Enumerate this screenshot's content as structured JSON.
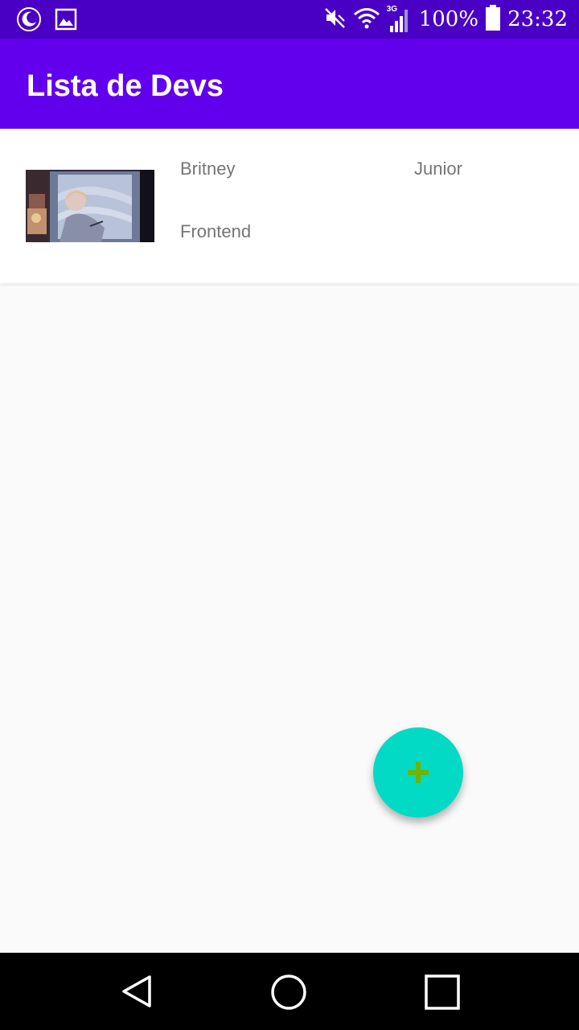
{
  "status_bar": {
    "battery_percent": "100%",
    "time": "23:32",
    "network_type": "3G",
    "icons": [
      "moon-icon",
      "image-icon",
      "mute-icon",
      "wifi-icon",
      "signal-icon",
      "battery-icon"
    ]
  },
  "app_bar": {
    "title": "Lista de Devs"
  },
  "developers": [
    {
      "name": "Britney",
      "level": "Junior",
      "area": "Frontend",
      "photo_icon": "developer-photo"
    }
  ],
  "fab": {
    "icon": "plus-icon",
    "color": "#03dac5"
  },
  "nav_bar": {
    "icons": [
      "back-icon",
      "home-icon",
      "recents-icon"
    ]
  },
  "colors": {
    "primary": "#6200ee",
    "primary_dark": "#4a00c4",
    "accent": "#03dac5"
  }
}
